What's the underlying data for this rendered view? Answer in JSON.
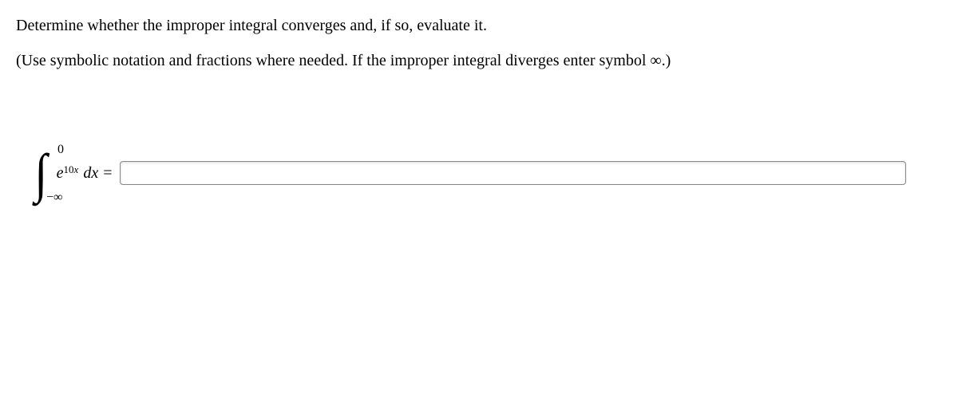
{
  "instructions": {
    "line1": "Determine whether the improper integral converges and, if so, evaluate it.",
    "line2": "(Use symbolic notation and fractions where needed. If the improper integral diverges enter symbol ∞.)"
  },
  "integral": {
    "upper_limit": "0",
    "lower_limit": "−∞",
    "base": "e",
    "exponent_coeff": "10",
    "exponent_var": "x",
    "differential": "dx",
    "equals": "="
  },
  "answer": {
    "value": "",
    "placeholder": ""
  }
}
